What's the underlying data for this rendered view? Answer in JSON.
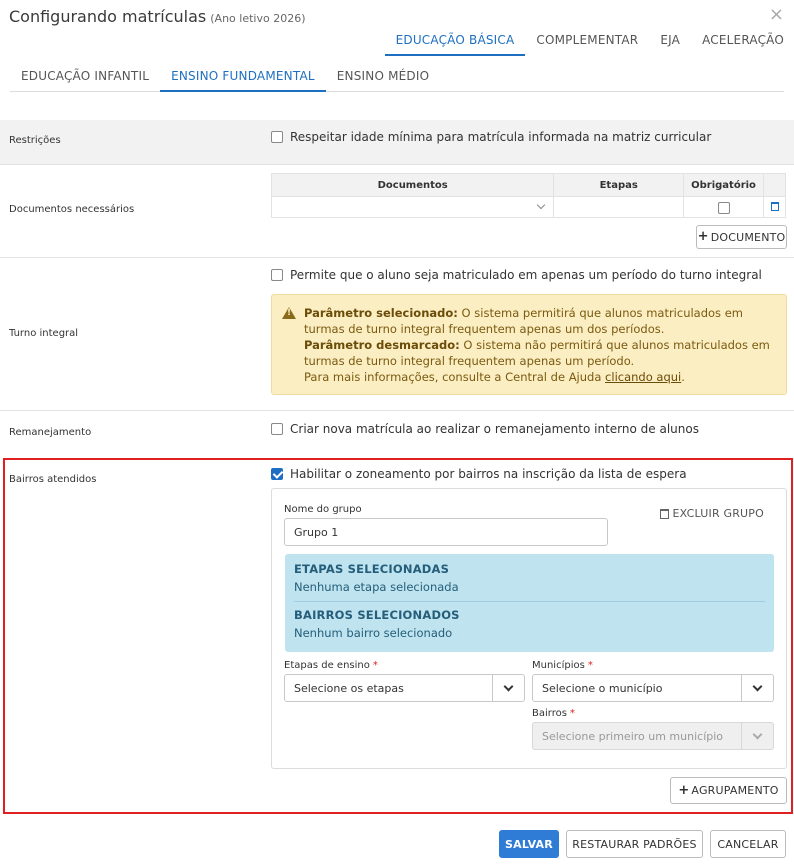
{
  "window": {
    "title": "Configurando matrículas",
    "subtitle": "(Ano letivo 2026)",
    "close_icon": "×"
  },
  "top_tabs": [
    {
      "label": "EDUCAÇÃO BÁSICA",
      "active": true
    },
    {
      "label": "COMPLEMENTAR",
      "active": false
    },
    {
      "label": "EJA",
      "active": false
    },
    {
      "label": "ACELERAÇÃO",
      "active": false
    }
  ],
  "sub_tabs": [
    {
      "label": "EDUCAÇÃO INFANTIL",
      "active": false
    },
    {
      "label": "ENSINO FUNDAMENTAL",
      "active": true
    },
    {
      "label": "ENSINO MÉDIO",
      "active": false
    }
  ],
  "restricoes": {
    "label": "Restrições",
    "checkbox_label": "Respeitar idade mínima para matrícula informada na matriz curricular",
    "checked": false
  },
  "documentos": {
    "label": "Documentos necessários",
    "col_documentos": "Documentos",
    "col_etapas": "Etapas",
    "col_obrigatorio": "Obrigatório",
    "row_obrigatorio_checked": false,
    "add_button": "DOCUMENTO"
  },
  "turno_integral": {
    "label": "Turno integral",
    "checkbox_label": "Permite que o aluno seja matriculado em apenas um período do turno integral",
    "checked": false,
    "warning": {
      "selected_title": "Parâmetro selecionado:",
      "selected_text": " O sistema permitirá que alunos matriculados em turmas de turno integral frequentem apenas um dos períodos.",
      "unselected_title": "Parâmetro desmarcado:",
      "unselected_text": " O sistema não permitirá que alunos matriculados em turmas de turno integral frequentem apenas um período.",
      "help_prefix": "Para mais informações, consulte a Central de Ajuda ",
      "help_link": "clicando aqui",
      "help_suffix": "."
    }
  },
  "remanejamento": {
    "label": "Remanejamento",
    "checkbox_label": "Criar nova matrícula ao realizar o remanejamento interno de alunos",
    "checked": false
  },
  "bairros": {
    "label": "Bairros atendidos",
    "checkbox_label": "Habilitar o zoneamento por bairros na inscrição da lista de espera",
    "checked": true,
    "group": {
      "name_label": "Nome do grupo",
      "name_value": "Grupo 1",
      "delete_label": "EXCLUIR GRUPO",
      "etapas_title": "ETAPAS SELECIONADAS",
      "etapas_text": "Nenhuma etapa selecionada",
      "bairros_title": "BAIRROS SELECIONADOS",
      "bairros_text": "Nenhum bairro selecionado",
      "etapas_label": "Etapas de ensino",
      "etapas_placeholder": "Selecione os etapas",
      "municipios_label": "Municípios",
      "municipios_placeholder": "Selecione o município",
      "bairros_field_label": "Bairros",
      "bairros_placeholder": "Selecione primeiro um município",
      "required_mark": "*"
    },
    "add_group_button": "AGRUPAMENTO"
  },
  "footer": {
    "save": "SALVAR",
    "restore": "RESTAURAR PADRÕES",
    "cancel": "CANCELAR"
  },
  "colors": {
    "accent": "#1e6fc1",
    "primary_button": "#2e7cd6",
    "highlight_border": "#e02020",
    "warning_bg": "#fbeec2",
    "info_bg": "#bfe3ef"
  }
}
